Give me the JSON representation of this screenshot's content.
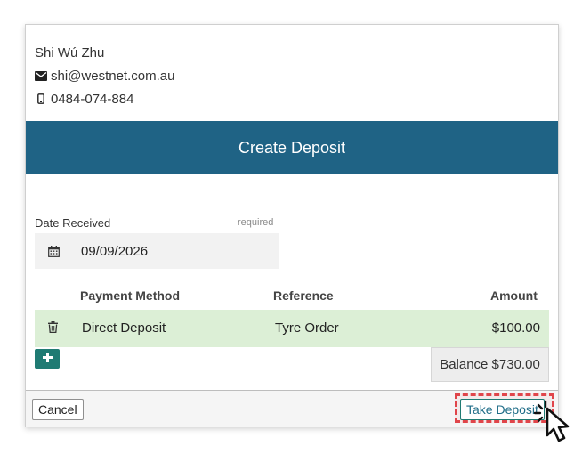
{
  "contact": {
    "name": "Shi Wú Zhu",
    "email": "shi@westnet.com.au",
    "phone": "0484-074-884"
  },
  "dialog": {
    "title": "Create Deposit"
  },
  "date_received": {
    "label": "Date Received",
    "required": "required",
    "value": "09/09/2026"
  },
  "table": {
    "headers": {
      "payment_method": "Payment Method",
      "reference": "Reference",
      "amount": "Amount"
    },
    "rows": [
      {
        "payment_method": "Direct Deposit",
        "reference": "Tyre Order",
        "amount": "$100.00"
      }
    ]
  },
  "balance": "Balance $730.00",
  "footer": {
    "cancel_label": "Cancel",
    "take_deposit_label": "Take Deposit"
  },
  "icons": {
    "email": "envelope-icon",
    "phone": "mobile-phone-icon",
    "date": "calendar-icon",
    "delete": "trash-icon",
    "add": "plus-icon"
  },
  "colors": {
    "header_bg": "#1f6385",
    "row_bg": "#dcefd6",
    "add_button": "#1f7b73",
    "highlight": "#e0454a"
  }
}
